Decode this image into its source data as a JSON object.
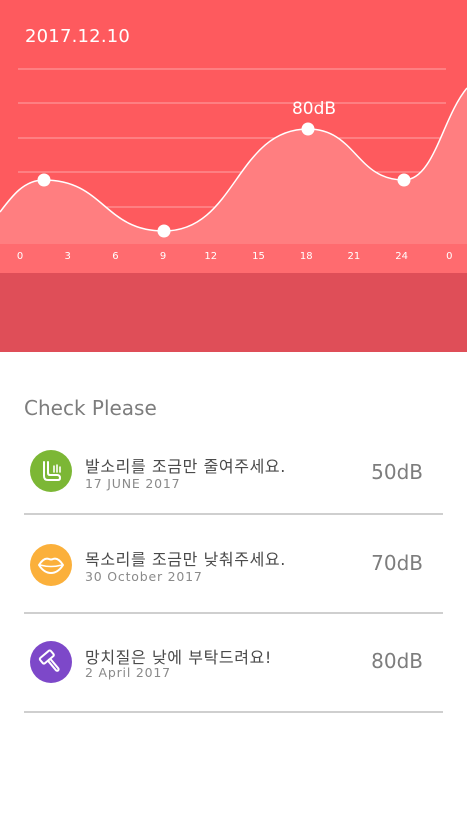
{
  "chart": {
    "date": "2017.12.10",
    "peak_label": "80dB",
    "x_ticks": [
      "0",
      "3",
      "6",
      "9",
      "12",
      "15",
      "18",
      "21",
      "24",
      "0"
    ],
    "colors": {
      "bg": "#fe5a5e",
      "fill": "#ff7e80",
      "band": "#df4e58"
    }
  },
  "chart_data": {
    "type": "area",
    "x_tick_labels": [
      "0",
      "3",
      "6",
      "9",
      "12",
      "15",
      "18",
      "21",
      "24",
      "0"
    ],
    "points": [
      {
        "x": 1.5,
        "y": 50
      },
      {
        "x": 9,
        "y": 20
      },
      {
        "x": 18,
        "y": 80,
        "label": "80dB"
      },
      {
        "x": 24,
        "y": 50
      }
    ],
    "grid": true
  },
  "list": {
    "title": "Check Please",
    "items": [
      {
        "title": "발소리를 조금만 줄여주세요.",
        "date": "17 JUNE 2017",
        "value": "50dB",
        "icon": "foot-icon",
        "color": "#7cb735"
      },
      {
        "title": "목소리를 조금만 낮춰주세요.",
        "date": "30 October 2017",
        "value": "70dB",
        "icon": "lips-icon",
        "color": "#fbb03b"
      },
      {
        "title": "망치질은 낮에 부탁드려요!",
        "date": "2 April 2017",
        "value": "80dB",
        "icon": "hammer-icon",
        "color": "#7d48c9"
      }
    ]
  }
}
